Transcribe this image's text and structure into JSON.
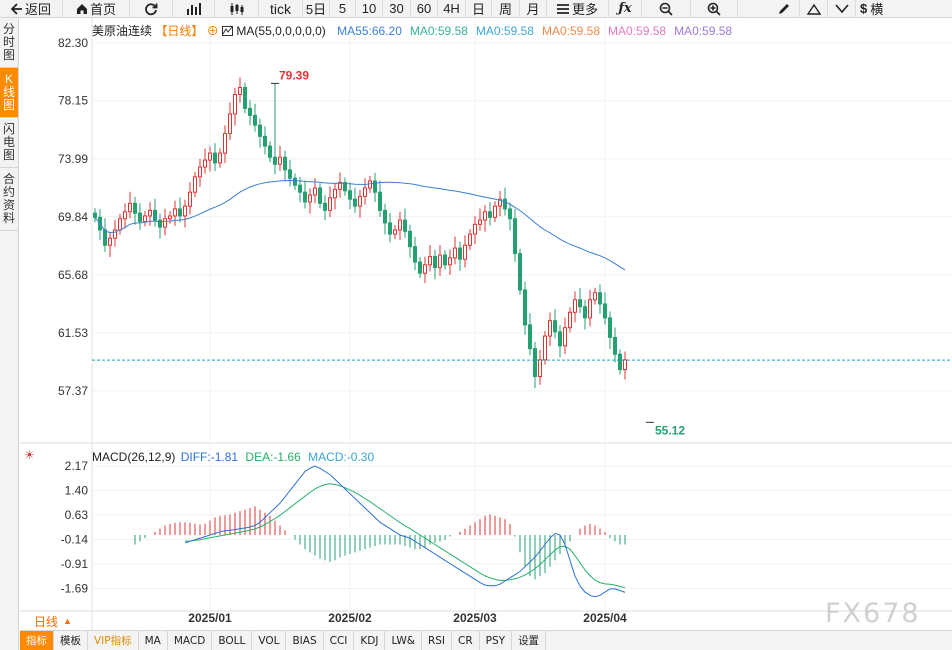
{
  "toolbar": {
    "back": "返回",
    "home": "首页",
    "tick": "tick",
    "periods": [
      "5日",
      "5",
      "10",
      "30",
      "60",
      "4H",
      "日",
      "周",
      "月"
    ],
    "more": "更多",
    "right_cut": "横"
  },
  "sidebar": [
    {
      "label": "分时图",
      "active": false
    },
    {
      "label": "K线图",
      "active": true
    },
    {
      "label": "闪电图",
      "active": false
    },
    {
      "label": "合约资料",
      "active": false
    }
  ],
  "legend": {
    "name": "美原油连续",
    "period": "【日线】",
    "ma_main": "MA(55,0,0,0,0,0)",
    "ma_items": [
      {
        "text": "MA55:66.20",
        "color": "#3a7fd5"
      },
      {
        "text": "MA0:59.58",
        "color": "#36b39a"
      },
      {
        "text": "MA0:59.58",
        "color": "#3aa6d6"
      },
      {
        "text": "MA0:59.58",
        "color": "#f08a4b"
      },
      {
        "text": "MA0:59.58",
        "color": "#e57ac0"
      },
      {
        "text": "MA0:59.58",
        "color": "#9c7ad8"
      }
    ]
  },
  "macd_legend": {
    "name": "MACD(26,12,9)",
    "diff": "DIFF:-1.81",
    "dea": "DEA:-1.66",
    "macd": "MACD:-0.30"
  },
  "colors": {
    "up": "#e23434",
    "down": "#25a070",
    "ma55": "#3a7fd5",
    "diff": "#2d6fd6",
    "dea": "#25b06a",
    "dash": "#1aa0b8"
  },
  "chart_data": {
    "type": "candlestick",
    "price_axis": {
      "ticks": [
        82.3,
        78.15,
        73.99,
        69.84,
        65.68,
        61.53,
        57.37
      ],
      "range": [
        54.0,
        83.5
      ]
    },
    "macd_axis": {
      "ticks": [
        2.17,
        1.4,
        0.63,
        -0.14,
        -0.91,
        -1.69
      ],
      "range": [
        -2.3,
        2.55
      ]
    },
    "x_labels": [
      "2025/01",
      "2025/02",
      "2025/03",
      "2025/04"
    ],
    "x_label_index": [
      23,
      51,
      76,
      102
    ],
    "high_label": "79.39",
    "high_index": 36,
    "low_label": "55.12",
    "low_index": 111,
    "last_price": 59.58,
    "closes": [
      69.8,
      68.9,
      67.8,
      68.3,
      68.9,
      69.7,
      70.2,
      70.8,
      70.1,
      69.5,
      69.9,
      70.3,
      69.6,
      69.1,
      69.7,
      69.9,
      70.4,
      69.9,
      70.6,
      71.6,
      72.7,
      73.4,
      73.9,
      74.4,
      73.7,
      74.4,
      75.8,
      77.2,
      78.6,
      79.1,
      77.6,
      77.1,
      76.4,
      75.6,
      74.9,
      74.1,
      73.6,
      74.1,
      73.2,
      72.6,
      72.1,
      71.6,
      70.9,
      71.4,
      71.9,
      70.8,
      70.3,
      71.2,
      71.8,
      72.3,
      71.7,
      71.1,
      70.6,
      71.3,
      71.9,
      72.4,
      71.6,
      70.3,
      69.4,
      68.6,
      68.9,
      69.6,
      68.8,
      67.7,
      66.6,
      65.8,
      66.4,
      67.0,
      66.2,
      67.1,
      66.4,
      66.9,
      67.6,
      66.8,
      67.8,
      68.6,
      69.3,
      69.6,
      70.2,
      69.8,
      70.6,
      71.1,
      70.4,
      69.7,
      67.2,
      64.6,
      62.1,
      60.4,
      58.4,
      59.6,
      61.3,
      62.4,
      61.6,
      60.6,
      61.9,
      63.0,
      63.9,
      63.4,
      62.6,
      63.9,
      64.4,
      63.6,
      62.6,
      61.2,
      60.0,
      58.9,
      59.6
    ],
    "ma55_start": 0,
    "diff": [
      -0.25,
      -0.2,
      -0.15,
      -0.1,
      -0.05,
      0.0,
      0.05,
      0.1,
      0.13,
      0.15,
      0.17,
      0.2,
      0.22,
      0.25,
      0.3,
      0.4,
      0.55,
      0.7,
      0.85,
      1.0,
      1.2,
      1.4,
      1.6,
      1.8,
      2.0,
      2.1,
      2.17,
      2.1,
      2.0,
      1.9,
      1.75,
      1.6,
      1.45,
      1.3,
      1.15,
      1.0,
      0.85,
      0.7,
      0.55,
      0.4,
      0.3,
      0.2,
      0.1,
      0.0,
      -0.05,
      -0.1,
      -0.2,
      -0.3,
      -0.4,
      -0.5,
      -0.6,
      -0.7,
      -0.8,
      -0.9,
      -1.0,
      -1.1,
      -1.2,
      -1.3,
      -1.4,
      -1.5,
      -1.58,
      -1.6,
      -1.6,
      -1.55,
      -1.45,
      -1.35,
      -1.25,
      -1.15,
      -1.0,
      -0.85,
      -0.7,
      -0.5,
      -0.3,
      -0.1,
      0.05,
      0.0,
      -0.3,
      -0.8,
      -1.3,
      -1.6,
      -1.8,
      -1.9,
      -1.95,
      -1.9,
      -1.8,
      -1.7,
      -1.7,
      -1.75,
      -1.81
    ],
    "dea": [
      -0.2,
      -0.19,
      -0.17,
      -0.15,
      -0.12,
      -0.09,
      -0.06,
      -0.03,
      0.0,
      0.03,
      0.06,
      0.09,
      0.12,
      0.15,
      0.19,
      0.25,
      0.33,
      0.42,
      0.52,
      0.62,
      0.74,
      0.86,
      0.98,
      1.1,
      1.22,
      1.34,
      1.45,
      1.53,
      1.59,
      1.61,
      1.59,
      1.55,
      1.49,
      1.42,
      1.34,
      1.25,
      1.15,
      1.05,
      0.94,
      0.83,
      0.72,
      0.61,
      0.5,
      0.39,
      0.29,
      0.2,
      0.1,
      0.0,
      -0.1,
      -0.2,
      -0.3,
      -0.4,
      -0.5,
      -0.6,
      -0.7,
      -0.8,
      -0.9,
      -1.0,
      -1.1,
      -1.2,
      -1.29,
      -1.35,
      -1.4,
      -1.43,
      -1.43,
      -1.41,
      -1.38,
      -1.33,
      -1.26,
      -1.17,
      -1.06,
      -0.93,
      -0.78,
      -0.62,
      -0.48,
      -0.37,
      -0.35,
      -0.45,
      -0.65,
      -0.88,
      -1.1,
      -1.28,
      -1.42,
      -1.5,
      -1.54,
      -1.55,
      -1.58,
      -1.62,
      -1.66
    ],
    "macd": [
      -0.3,
      -0.2,
      -0.1,
      0.0,
      0.1,
      0.2,
      0.3,
      0.35,
      0.38,
      0.4,
      0.4,
      0.38,
      0.35,
      0.33,
      0.35,
      0.45,
      0.55,
      0.6,
      0.62,
      0.65,
      0.7,
      0.75,
      0.8,
      0.85,
      0.9,
      0.8,
      0.7,
      0.6,
      0.45,
      0.3,
      0.15,
      0.0,
      -0.15,
      -0.3,
      -0.45,
      -0.55,
      -0.65,
      -0.75,
      -0.8,
      -0.85,
      -0.8,
      -0.7,
      -0.65,
      -0.6,
      -0.55,
      -0.5,
      -0.45,
      -0.4,
      -0.35,
      -0.3,
      -0.3,
      -0.3,
      -0.3,
      -0.3,
      -0.35,
      -0.4,
      -0.45,
      -0.45,
      -0.4,
      -0.3,
      -0.25,
      -0.2,
      -0.15,
      -0.05,
      0.0,
      0.1,
      0.2,
      0.3,
      0.4,
      0.5,
      0.6,
      0.65,
      0.6,
      0.55,
      0.5,
      0.35,
      -0.05,
      -0.55,
      -1.0,
      -1.3,
      -1.4,
      -1.3,
      -1.2,
      -1.0,
      -0.8,
      -0.6,
      -0.4,
      -0.2,
      0.0,
      0.2,
      0.3,
      0.35,
      0.3,
      0.2,
      0.1,
      -0.1,
      -0.2,
      -0.3,
      -0.3
    ]
  },
  "bottom": {
    "period_label": "日线",
    "tabs": [
      {
        "label": "指标",
        "active": true,
        "vip": false
      },
      {
        "label": "模板",
        "active": false,
        "vip": false
      },
      {
        "label": "VIP指标",
        "active": false,
        "vip": true
      },
      {
        "label": "MA",
        "active": false,
        "vip": false
      },
      {
        "label": "MACD",
        "active": false,
        "vip": false
      },
      {
        "label": "BOLL",
        "active": false,
        "vip": false
      },
      {
        "label": "VOL",
        "active": false,
        "vip": false
      },
      {
        "label": "BIAS",
        "active": false,
        "vip": false
      },
      {
        "label": "CCI",
        "active": false,
        "vip": false
      },
      {
        "label": "KDJ",
        "active": false,
        "vip": false
      },
      {
        "label": "LW&",
        "active": false,
        "vip": false
      },
      {
        "label": "RSI",
        "active": false,
        "vip": false
      },
      {
        "label": "CR",
        "active": false,
        "vip": false
      },
      {
        "label": "PSY",
        "active": false,
        "vip": false
      },
      {
        "label": "设置",
        "active": false,
        "vip": false
      }
    ]
  },
  "watermark": "FX678"
}
